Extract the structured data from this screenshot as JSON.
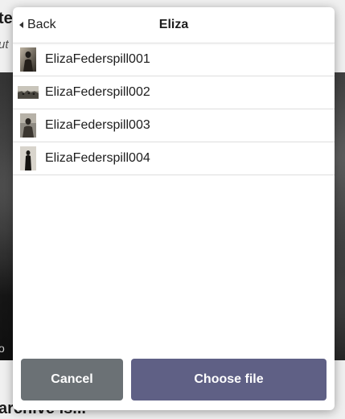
{
  "background": {
    "heading": "te",
    "subtitle": "ut",
    "caption": "o",
    "bottom_heading": "archive is..."
  },
  "modal": {
    "back_label": "Back",
    "title": "Eliza",
    "files": [
      {
        "name": "ElizaFederspill001",
        "thumb": "portrait-photo-icon"
      },
      {
        "name": "ElizaFederspill002",
        "thumb": "landscape-photo-icon"
      },
      {
        "name": "ElizaFederspill003",
        "thumb": "portrait-photo-icon"
      },
      {
        "name": "ElizaFederspill004",
        "thumb": "portrait-photo-icon"
      }
    ],
    "cancel_label": "Cancel",
    "choose_label": "Choose file"
  },
  "colors": {
    "cancel_button": "#6b7175",
    "choose_button": "#5f6085"
  }
}
